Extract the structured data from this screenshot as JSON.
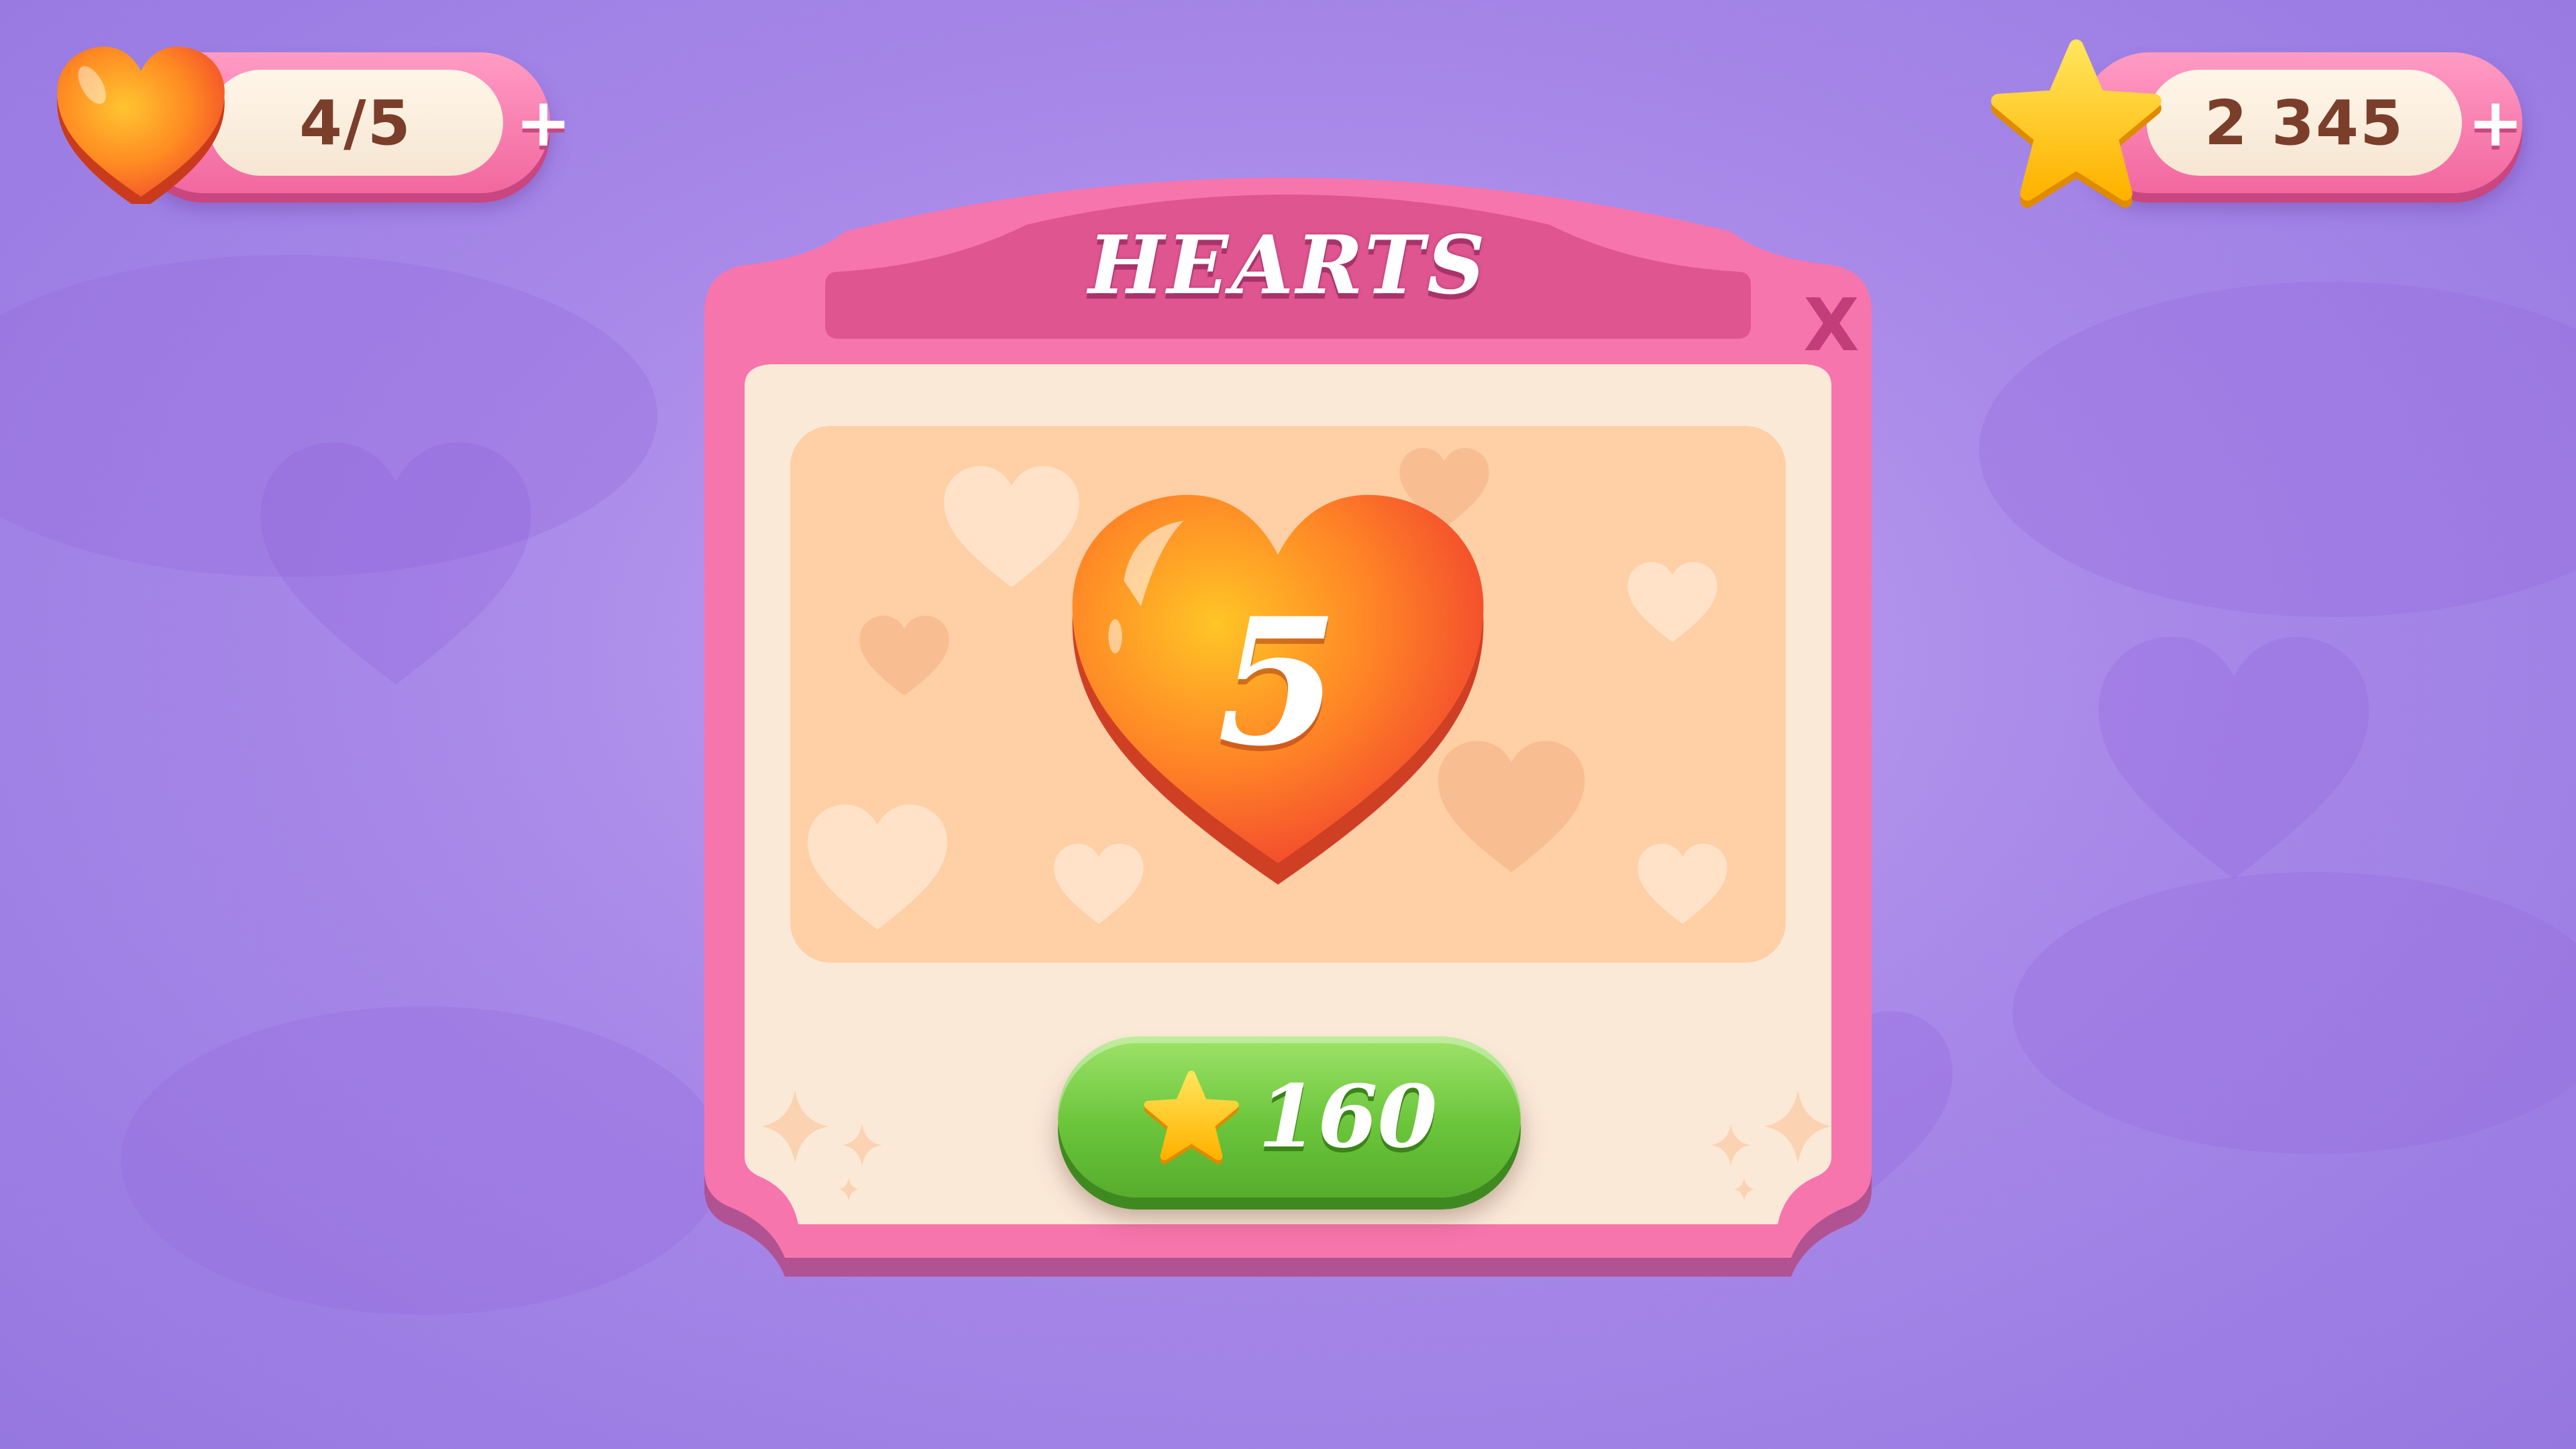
{
  "hud": {
    "lives": {
      "value": "4/5",
      "icon": "heart-icon",
      "plus_label": "+"
    },
    "stars": {
      "value": "2 345",
      "icon": "star-icon",
      "plus_label": "+"
    }
  },
  "dialog": {
    "title": "HEARTS",
    "close_label": "X",
    "reward": {
      "icon": "heart-icon",
      "count": "5"
    },
    "buy_button": {
      "icon": "star-icon",
      "price": "160"
    }
  },
  "colors": {
    "background": "#a98ae9",
    "frame_pink": "#f46fa6",
    "panel_cream": "#fbe9d8",
    "showcase_peach": "#ffcfa5",
    "heart_orange": "#ff6a2e",
    "star_yellow": "#ffc21a",
    "button_green": "#6bc53b"
  }
}
